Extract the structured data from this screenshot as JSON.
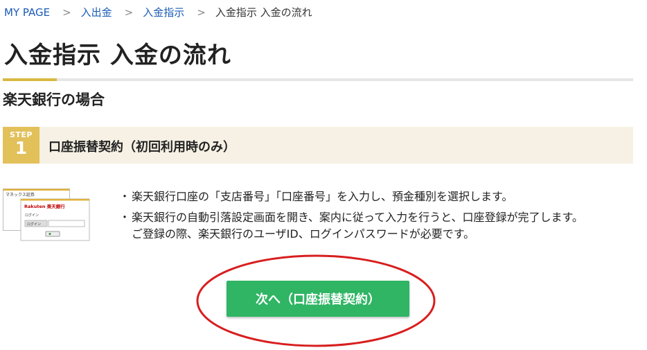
{
  "breadcrumb": {
    "items": [
      "MY PAGE",
      "入出金",
      "入金指示"
    ],
    "separator": ">",
    "current": "入金指示 入金の流れ"
  },
  "page_title": "入金指示 入金の流れ",
  "section_heading": "楽天銀行の場合",
  "step": {
    "word": "STEP",
    "number": "1",
    "title": "口座振替契約（初回利用時のみ）"
  },
  "thumbnail": {
    "header_text": "マネックス証券",
    "bank_logo": "Rakuten 楽天銀行",
    "login_caption": "ログイン",
    "login_label": "ログイン"
  },
  "bullets": {
    "mark": "・",
    "items": [
      [
        "楽天銀行口座の「支店番号」「口座番号」を入力し、預金種別を選択します。"
      ],
      [
        "楽天銀行の自動引落設定画面を開き、案内に従って入力を行うと、口座登録が完了します。",
        "ご登録の際、楽天銀行のユーザID、ログインパスワードが必要です。"
      ]
    ]
  },
  "next_button_label": "次へ（口座振替契約）",
  "colors": {
    "link": "#1a5bb5",
    "accent_gold": "#d9b840",
    "step_badge": "#e2c05a",
    "step_bar_bg": "#f6f1e4",
    "button_green": "#2fb564",
    "highlight_red": "#d81e1e"
  }
}
